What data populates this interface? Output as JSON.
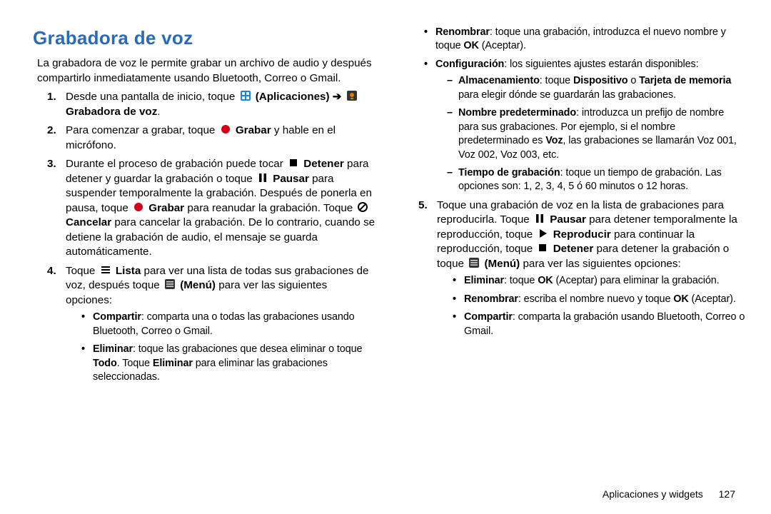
{
  "heading": "Grabadora de voz",
  "intro": "La grabadora de voz le permite grabar un archivo de audio y después compartirlo inmediatamente usando Bluetooth, Correo o Gmail.",
  "step1_a": "Desde una pantalla de inicio, toque ",
  "step1_apps": " (Aplicaciones)",
  "step1_arrow": " ➔ ",
  "step1_gv": " Grabadora de voz",
  "step1_dot": ".",
  "step2_a": "Para comenzar a grabar, toque ",
  "step2_grabar": " Grabar",
  "step2_b": " y hable en el micrófono.",
  "step3_a": "Durante el proceso de grabación puede tocar ",
  "step3_det": " Detener",
  "step3_b": " para detener y guardar la grabación o toque ",
  "step3_pau": " Pausar",
  "step3_c": " para suspender temporalmente la grabación. Después de ponerla en pausa, toque ",
  "step3_grabar": " Grabar",
  "step3_d": " para reanudar la grabación. Toque ",
  "step3_cancel": " Cancelar",
  "step3_e": " para cancelar la grabación. De lo contrario, cuando se detiene la grabación de audio, el mensaje se guarda automáticamente.",
  "step4_a": "Toque ",
  "step4_list": " Lista",
  "step4_b": " para ver una lista de todas sus grabaciones de voz, después toque ",
  "step4_menu": " (Menú)",
  "step4_c": " para ver las siguientes opciones:",
  "b4_share_t": "Compartir",
  "b4_share": ": comparta una o todas las grabaciones usando Bluetooth, Correo o Gmail.",
  "b4_elim_t": "Eliminar",
  "b4_elim_a": ": toque las grabaciones que desea eliminar o toque ",
  "b4_elim_todo": "Todo",
  "b4_elim_b": ". Toque ",
  "b4_elim_el": "Eliminar",
  "b4_elim_c": " para eliminar las grabaciones seleccionadas.",
  "b4_ren_t": "Renombrar",
  "b4_ren_a": ": toque una grabación, introduzca el nuevo nombre y toque ",
  "b4_ren_ok": "OK",
  "b4_ren_b": " (Aceptar).",
  "b4_conf_t": "Configuración",
  "b4_conf": ": los siguientes ajustes estarán disponibles:",
  "d_alm_t": "Almacenamiento",
  "d_alm_a": ": toque ",
  "d_alm_disp": "Dispositivo",
  "d_alm_o": " o ",
  "d_alm_tarj": "Tarjeta de memoria",
  "d_alm_b": " para elegir dónde se guardarán las grabaciones.",
  "d_nom_t": "Nombre predeterminado",
  "d_nom_a": ": introduzca un prefijo de nombre para sus grabaciones. Por ejemplo, si el nombre predeterminado es ",
  "d_nom_voz": "Voz",
  "d_nom_b": ", las grabaciones se llamarán Voz 001, Voz 002, Voz 003, etc.",
  "d_tmp_t": "Tiempo de grabación",
  "d_tmp": ": toque un tiempo de grabación. Las opciones son: 1, 2, 3, 4, 5 ó 60 minutos o 12 horas.",
  "step5_a": "Toque una grabación de voz en la lista de grabaciones para reproducirla. Toque ",
  "step5_pau": " Pausar",
  "step5_b": " para detener temporalmente la reproducción, toque ",
  "step5_rep": " Reproducir",
  "step5_c": " para continuar la reproducción, toque ",
  "step5_det": " Detener",
  "step5_d": " para detener la grabación o toque ",
  "step5_menu": " (Menú)",
  "step5_e": " para ver las siguientes opciones:",
  "b5_elim_t": "Eliminar",
  "b5_elim_a": ": toque ",
  "b5_elim_ok": "OK",
  "b5_elim_b": " (Aceptar) para eliminar la grabación.",
  "b5_ren_t": "Renombrar",
  "b5_ren_a": ": escriba el nombre nuevo y toque ",
  "b5_ren_ok": "OK",
  "b5_ren_b": " (Aceptar).",
  "b5_share_t": "Compartir",
  "b5_share": ": comparta la grabación usando Bluetooth, Correo o Gmail.",
  "footer_section": "Aplicaciones y widgets",
  "footer_page": "127"
}
